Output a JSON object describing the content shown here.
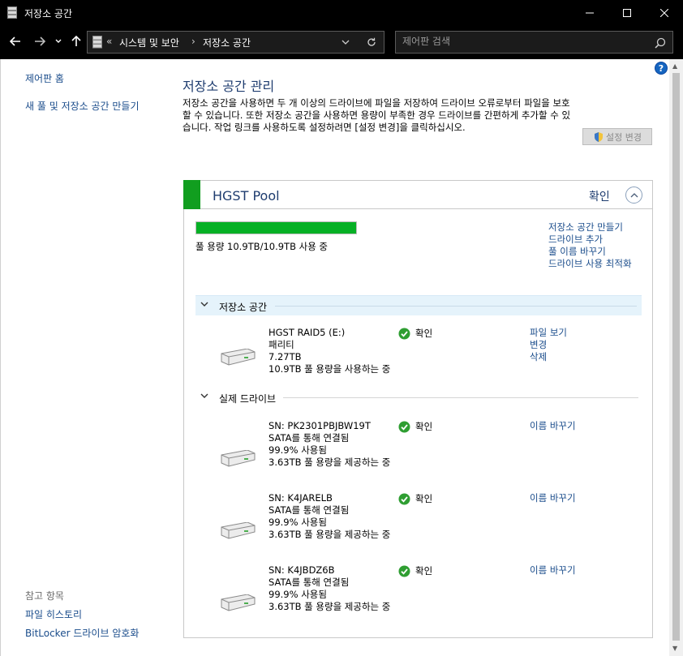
{
  "window": {
    "title": "저장소 공간",
    "app_icon": "storage-spaces-icon"
  },
  "address": {
    "overflow": "«",
    "crumbs": [
      "시스템 및 보안",
      "저장소 공간"
    ]
  },
  "search": {
    "placeholder": "제어판 검색"
  },
  "sidebar": {
    "home": "제어판 홈",
    "create_pool": "새 풀 및 저장소 공간 만들기",
    "see_also": "참고 항목",
    "file_history": "파일 히스토리",
    "bitlocker": "BitLocker 드라이브 암호화"
  },
  "main": {
    "title": "저장소 공간 관리",
    "description": "저장소 공간을 사용하면 두 개 이상의 드라이브에 파일을 저장하여 드라이브 오류로부터 파일을 보호할 수 있습니다. 또한 저장소 공간을 사용하면 용량이 부족한 경우 드라이브를 간편하게 추가할 수 있습니다. 작업 링크를 사용하도록 설정하려면 [설정 변경]을 클릭하십시오.",
    "settings_button": "설정 변경"
  },
  "pool": {
    "name": "HGST Pool",
    "status": "확인",
    "usage_fraction": 1.0,
    "capacity_text": "풀 용량 10.9TB/10.9TB 사용 중",
    "links": [
      "저장소 공간 만들기",
      "드라이브 추가",
      "풀 이름 바꾸기",
      "드라이브 사용 최적화"
    ],
    "spaces_label": "저장소 공간",
    "drives_label": "실제 드라이브",
    "spaces": [
      {
        "lines": [
          "HGST RAID5 (E:)",
          "패리티",
          "7.27TB",
          "10.9TB 풀 용량을 사용하는 중"
        ],
        "status": "확인",
        "links": [
          "파일 보기",
          "변경",
          "삭제"
        ]
      }
    ],
    "drives": [
      {
        "lines": [
          "SN: PK2301PBJBW19T",
          "SATA를 통해 연결됨",
          "99.9% 사용됨",
          "3.63TB 풀 용량을 제공하는 중"
        ],
        "status": "확인",
        "link": "이름 바꾸기"
      },
      {
        "lines": [
          "SN: K4JARELB",
          "SATA를 통해 연결됨",
          "99.9% 사용됨",
          "3.63TB 풀 용량을 제공하는 중"
        ],
        "status": "확인",
        "link": "이름 바꾸기"
      },
      {
        "lines": [
          "SN: K4JBDZ6B",
          "SATA를 통해 연결됨",
          "99.9% 사용됨",
          "3.63TB 풀 용량을 제공하는 중"
        ],
        "status": "확인",
        "link": "이름 바꾸기"
      }
    ]
  },
  "colors": {
    "accent": "#119e1f",
    "link": "#1a4c8b",
    "title": "#1e3c6f",
    "bar": "#06b025"
  }
}
